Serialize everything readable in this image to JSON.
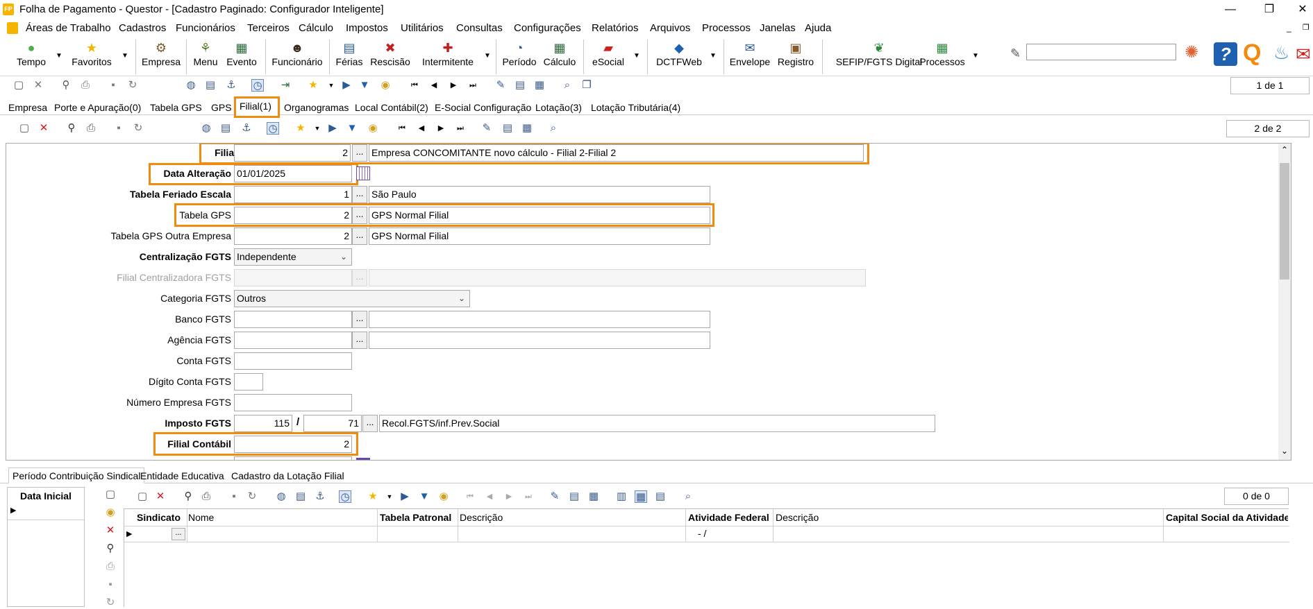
{
  "window": {
    "title": "Folha de Pagamento - Questor - [Cadastro Paginado: Configurador Inteligente]",
    "minimize": "—",
    "restore": "❐",
    "close": "✕"
  },
  "menu": [
    "Áreas de Trabalho",
    "Cadastros",
    "Funcionários",
    "Terceiros",
    "Cálculo",
    "Impostos",
    "Utilitários",
    "Consultas",
    "Configurações",
    "Relatórios",
    "Arquivos",
    "Processos",
    "Janelas",
    "Ajuda"
  ],
  "toolbar": {
    "tempo": "Tempo",
    "favoritos": "Favoritos",
    "empresa": "Empresa",
    "menu": "Menu",
    "evento": "Evento",
    "funcionario": "Funcionário",
    "ferias": "Férias",
    "rescisao": "Rescisão",
    "intermitente": "Intermitente",
    "periodo": "Período",
    "calculo": "Cálculo",
    "esocial": "eSocial",
    "dctfweb": "DCTFWeb",
    "envelope": "Envelope",
    "registro": "Registro",
    "sefip": "SEFIP/FGTS Digital",
    "processos": "Processos",
    "search_value": ""
  },
  "nav_top": {
    "page": "1 de 1"
  },
  "tabs": [
    "Empresa",
    "Porte e Apuração(0)",
    "Tabela GPS",
    "GPS",
    "Filial(1)",
    "Organogramas",
    "Local Contábil(2)",
    "E-Social Configuração",
    "Lotação(3)",
    "Lotação Tributária(4)"
  ],
  "nav_mid": {
    "page": "2 de 2"
  },
  "form": {
    "filial": {
      "label": "Filial",
      "code": "2",
      "desc": "Empresa CONCOMITANTE novo cálculo - Filial 2-Filial 2"
    },
    "data_alteracao": {
      "label": "Data Alteração",
      "value": "01/01/2025"
    },
    "tabela_feriado": {
      "label": "Tabela Feriado Escala",
      "code": "1",
      "desc": "São Paulo"
    },
    "tabela_gps": {
      "label": "Tabela GPS",
      "code": "2",
      "desc": "GPS Normal Filial"
    },
    "tabela_gps_outra": {
      "label": "Tabela GPS Outra Empresa",
      "code": "2",
      "desc": "GPS Normal Filial"
    },
    "centralizacao": {
      "label": "Centralização FGTS",
      "value": "Independente"
    },
    "filial_centralizadora": {
      "label": "Filial Centralizadora FGTS",
      "code": "",
      "desc": ""
    },
    "categoria": {
      "label": "Categoria FGTS",
      "value": "Outros"
    },
    "banco": {
      "label": "Banco FGTS",
      "code": "",
      "desc": ""
    },
    "agencia": {
      "label": "Agência FGTS",
      "code": "",
      "desc": ""
    },
    "conta": {
      "label": "Conta FGTS",
      "value": ""
    },
    "digito": {
      "label": "Dígito Conta FGTS",
      "value": ""
    },
    "numero_empresa": {
      "label": "Número Empresa FGTS",
      "value": ""
    },
    "imposto": {
      "label": "Imposto FGTS",
      "code": "115",
      "sep": "/",
      "code2": "71",
      "desc": "Recol.FGTS/inf.Prev.Social"
    },
    "filial_contabil": {
      "label": "Filial Contábil",
      "value": "2"
    },
    "ellipsis": "..."
  },
  "bottom_tabs": [
    "Período Contribuição Sindical",
    "Entidade Educativa",
    "Cadastro da Lotação Filial"
  ],
  "bottom": {
    "left_header": "Data Inicial",
    "page": "0 de 0",
    "columns": [
      "Sindicato",
      "Nome",
      "Tabela Patronal",
      "Descrição",
      "Atividade Federal",
      "Descrição",
      "Capital Social da Atividade"
    ],
    "row_cell": "- /",
    "ellipsis": "..."
  },
  "colors": {
    "highlight": "#f28a10",
    "accent_blue": "#1f5fb0",
    "delete_red": "#d71920"
  }
}
